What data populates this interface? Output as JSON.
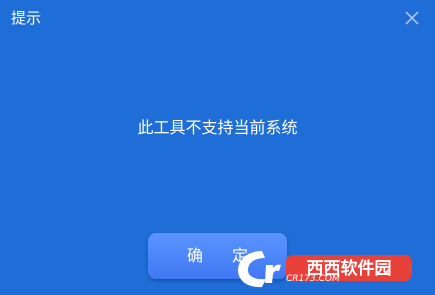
{
  "dialog": {
    "title": "提示",
    "message": "此工具不支持当前系统",
    "ok_label": "确 定"
  },
  "icons": {
    "close": "close-icon"
  },
  "colors": {
    "background": "#1f6ed8",
    "button": "#4a85f8",
    "text": "#ffffff"
  },
  "watermark": {
    "brand": "西西软件园",
    "site": "CR173.COM"
  }
}
